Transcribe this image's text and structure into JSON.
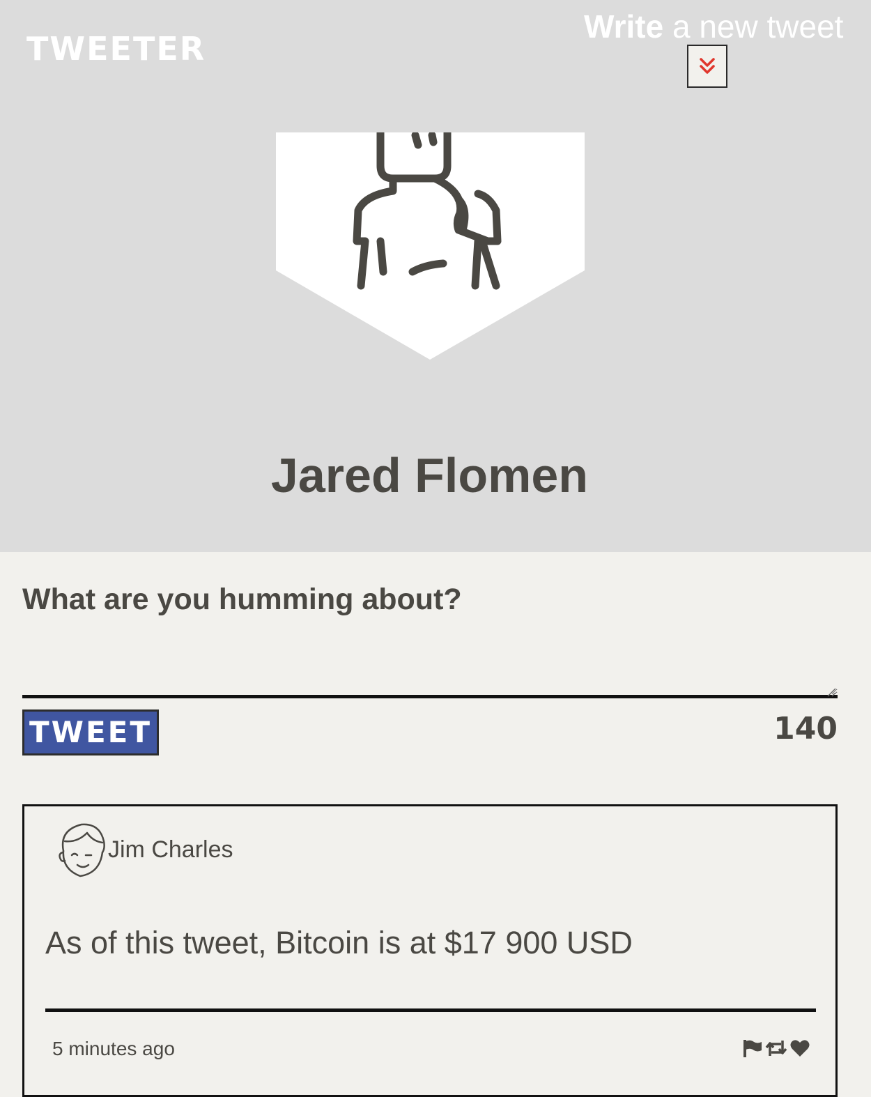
{
  "nav": {
    "brand": "TWEETER",
    "compose_bold": "Write",
    "compose_rest": " a new tweet",
    "toggle_icon": "double-chevron-down-icon"
  },
  "profile": {
    "avatar_icon": "person-avatar-icon",
    "name": "Jared Flomen"
  },
  "composer": {
    "label": "What are you humming about?",
    "value": "",
    "button_label": "TWEET",
    "char_count": "140"
  },
  "tweets": [
    {
      "avatar_icon": "face-avatar-icon",
      "author": "Jim Charles",
      "body": "As of this tweet, Bitcoin is at $17 900 USD",
      "time": "5 minutes ago",
      "actions": [
        "flag-icon",
        "retweet-icon",
        "heart-icon"
      ]
    }
  ],
  "colors": {
    "header_bg": "#dcdcdc",
    "page_bg": "#f2f1ed",
    "tweet_button": "#4056a1",
    "chevron": "#e0362c",
    "text": "#4a4843"
  }
}
